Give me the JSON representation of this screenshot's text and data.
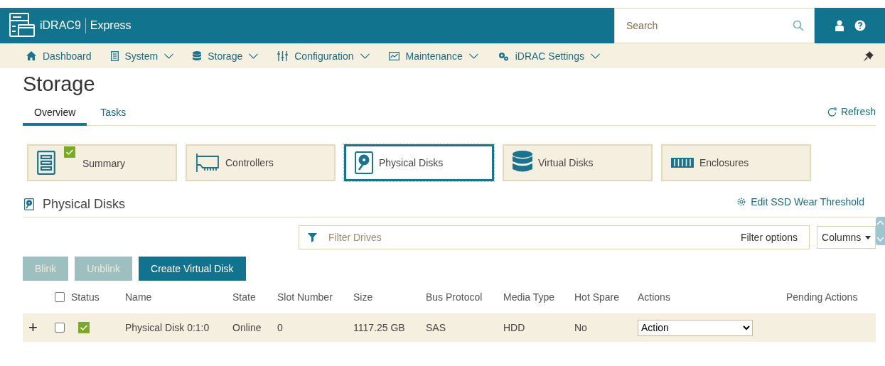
{
  "header": {
    "product": "iDRAC9",
    "edition": "Express",
    "search": {
      "placeholder": "Search"
    }
  },
  "nav": [
    {
      "label": "Dashboard",
      "dropdown": false
    },
    {
      "label": "System",
      "dropdown": true
    },
    {
      "label": "Storage",
      "dropdown": true
    },
    {
      "label": "Configuration",
      "dropdown": true
    },
    {
      "label": "Maintenance",
      "dropdown": true
    },
    {
      "label": "iDRAC Settings",
      "dropdown": true
    }
  ],
  "page": {
    "title": "Storage",
    "refresh": "Refresh"
  },
  "tabs": [
    {
      "label": "Overview",
      "selected": true
    },
    {
      "label": "Tasks",
      "selected": false
    }
  ],
  "cards": [
    {
      "label": "Summary",
      "selected": false,
      "healthy": true
    },
    {
      "label": "Controllers",
      "selected": false,
      "healthy": false
    },
    {
      "label": "Physical Disks",
      "selected": true,
      "healthy": false
    },
    {
      "label": "Virtual Disks",
      "selected": false,
      "healthy": false
    },
    {
      "label": "Enclosures",
      "selected": false,
      "healthy": false
    }
  ],
  "section": {
    "title": "Physical Disks",
    "link": "Edit SSD Wear Threshold"
  },
  "filter": {
    "placeholder": "Filter Drives",
    "options": "Filter options",
    "columns": "Columns"
  },
  "buttons": [
    {
      "label": "Blink",
      "disabled": true
    },
    {
      "label": "Unblink",
      "disabled": true
    },
    {
      "label": "Create Virtual Disk",
      "disabled": false
    }
  ],
  "table": {
    "select_all": {
      "checked": false
    },
    "status_header": "Status",
    "columns": [
      "Name",
      "State",
      "Slot Number",
      "Size",
      "Bus Protocol",
      "Media Type",
      "Hot Spare",
      "Actions",
      "Pending Actions"
    ],
    "rows": [
      {
        "expand": "+",
        "checked": false,
        "healthy": true,
        "cells": [
          "Physical Disk 0:1:0",
          "Online",
          "0",
          "1117.25 GB",
          "SAS",
          "HDD",
          "No"
        ],
        "action": "Action"
      }
    ]
  }
}
